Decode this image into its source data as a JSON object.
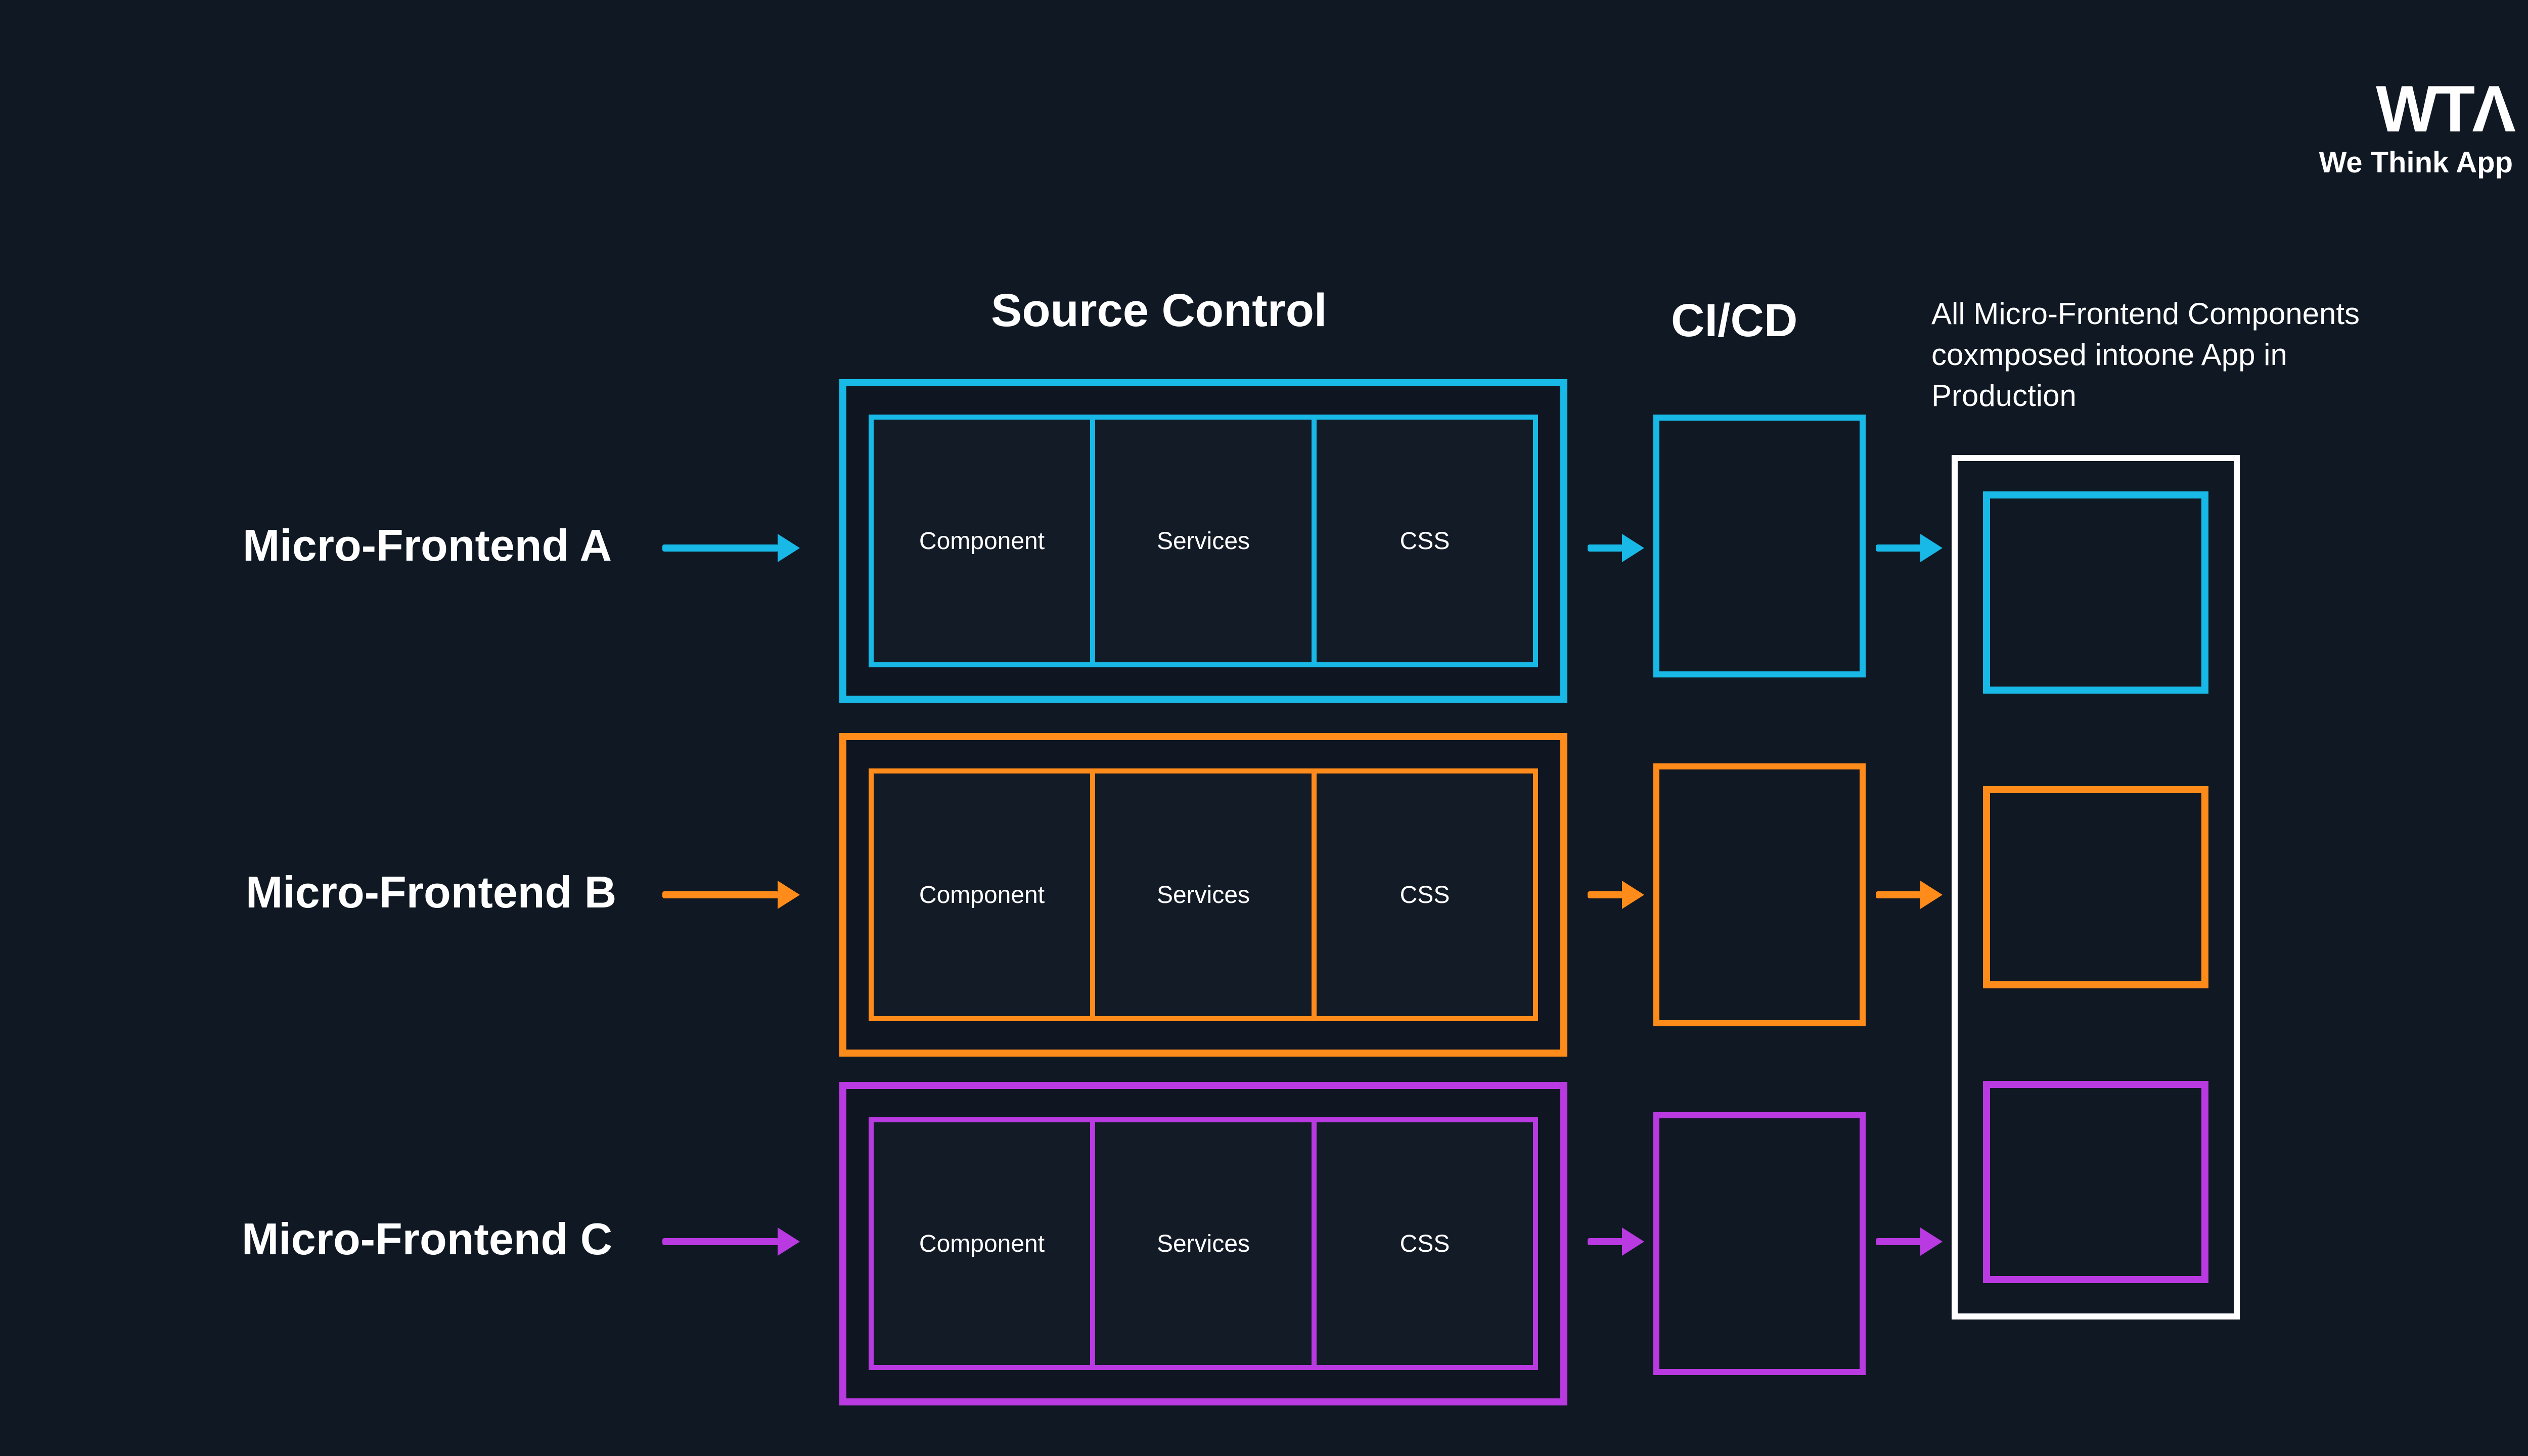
{
  "logo": {
    "mark": "WTΛ",
    "tagline": "We Think App"
  },
  "headings": {
    "source": "Source Control",
    "cicd": "CI/CD",
    "production": "All Micro-Frontend Components coxmposed intoone App in Production"
  },
  "rows": [
    {
      "id": "A",
      "label": "Micro-Frontend A",
      "color": "#18b9e6",
      "cells": [
        "Component",
        "Services",
        "CSS"
      ]
    },
    {
      "id": "B",
      "label": "Micro-Frontend B",
      "color": "#ff8c1a",
      "cells": [
        "Component",
        "Services",
        "CSS"
      ]
    },
    {
      "id": "C",
      "label": "Micro-Frontend C",
      "color": "#b93ae0",
      "cells": [
        "Component",
        "Services",
        "CSS"
      ]
    }
  ]
}
